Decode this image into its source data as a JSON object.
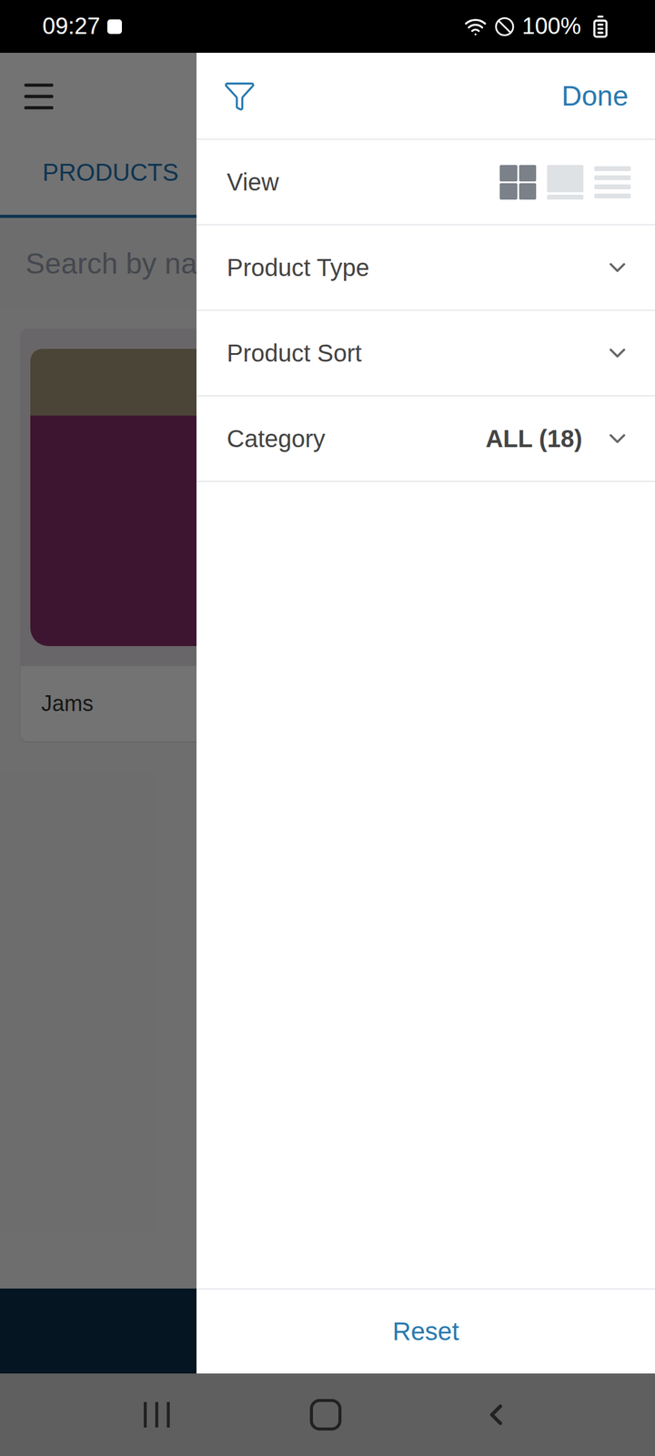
{
  "status_bar": {
    "time": "09:27",
    "battery": "100%"
  },
  "background": {
    "tab": "PRODUCTS",
    "search_placeholder": "Search by na",
    "products": [
      {
        "label": "Jams"
      }
    ]
  },
  "drawer": {
    "done": "Done",
    "rows": [
      {
        "kind": "view",
        "label": "View",
        "options": [
          {
            "kind": "grid",
            "selected": true
          },
          {
            "kind": "card",
            "selected": false
          },
          {
            "kind": "list",
            "selected": false
          }
        ]
      },
      {
        "kind": "dropdown",
        "label": "Product Type",
        "value": "",
        "expanded": false
      },
      {
        "kind": "dropdown",
        "label": "Product Sort",
        "value": "",
        "expanded": false
      },
      {
        "kind": "dropdown",
        "label": "Category",
        "value": "ALL (18)",
        "expanded": false
      }
    ],
    "reset": "Reset"
  }
}
